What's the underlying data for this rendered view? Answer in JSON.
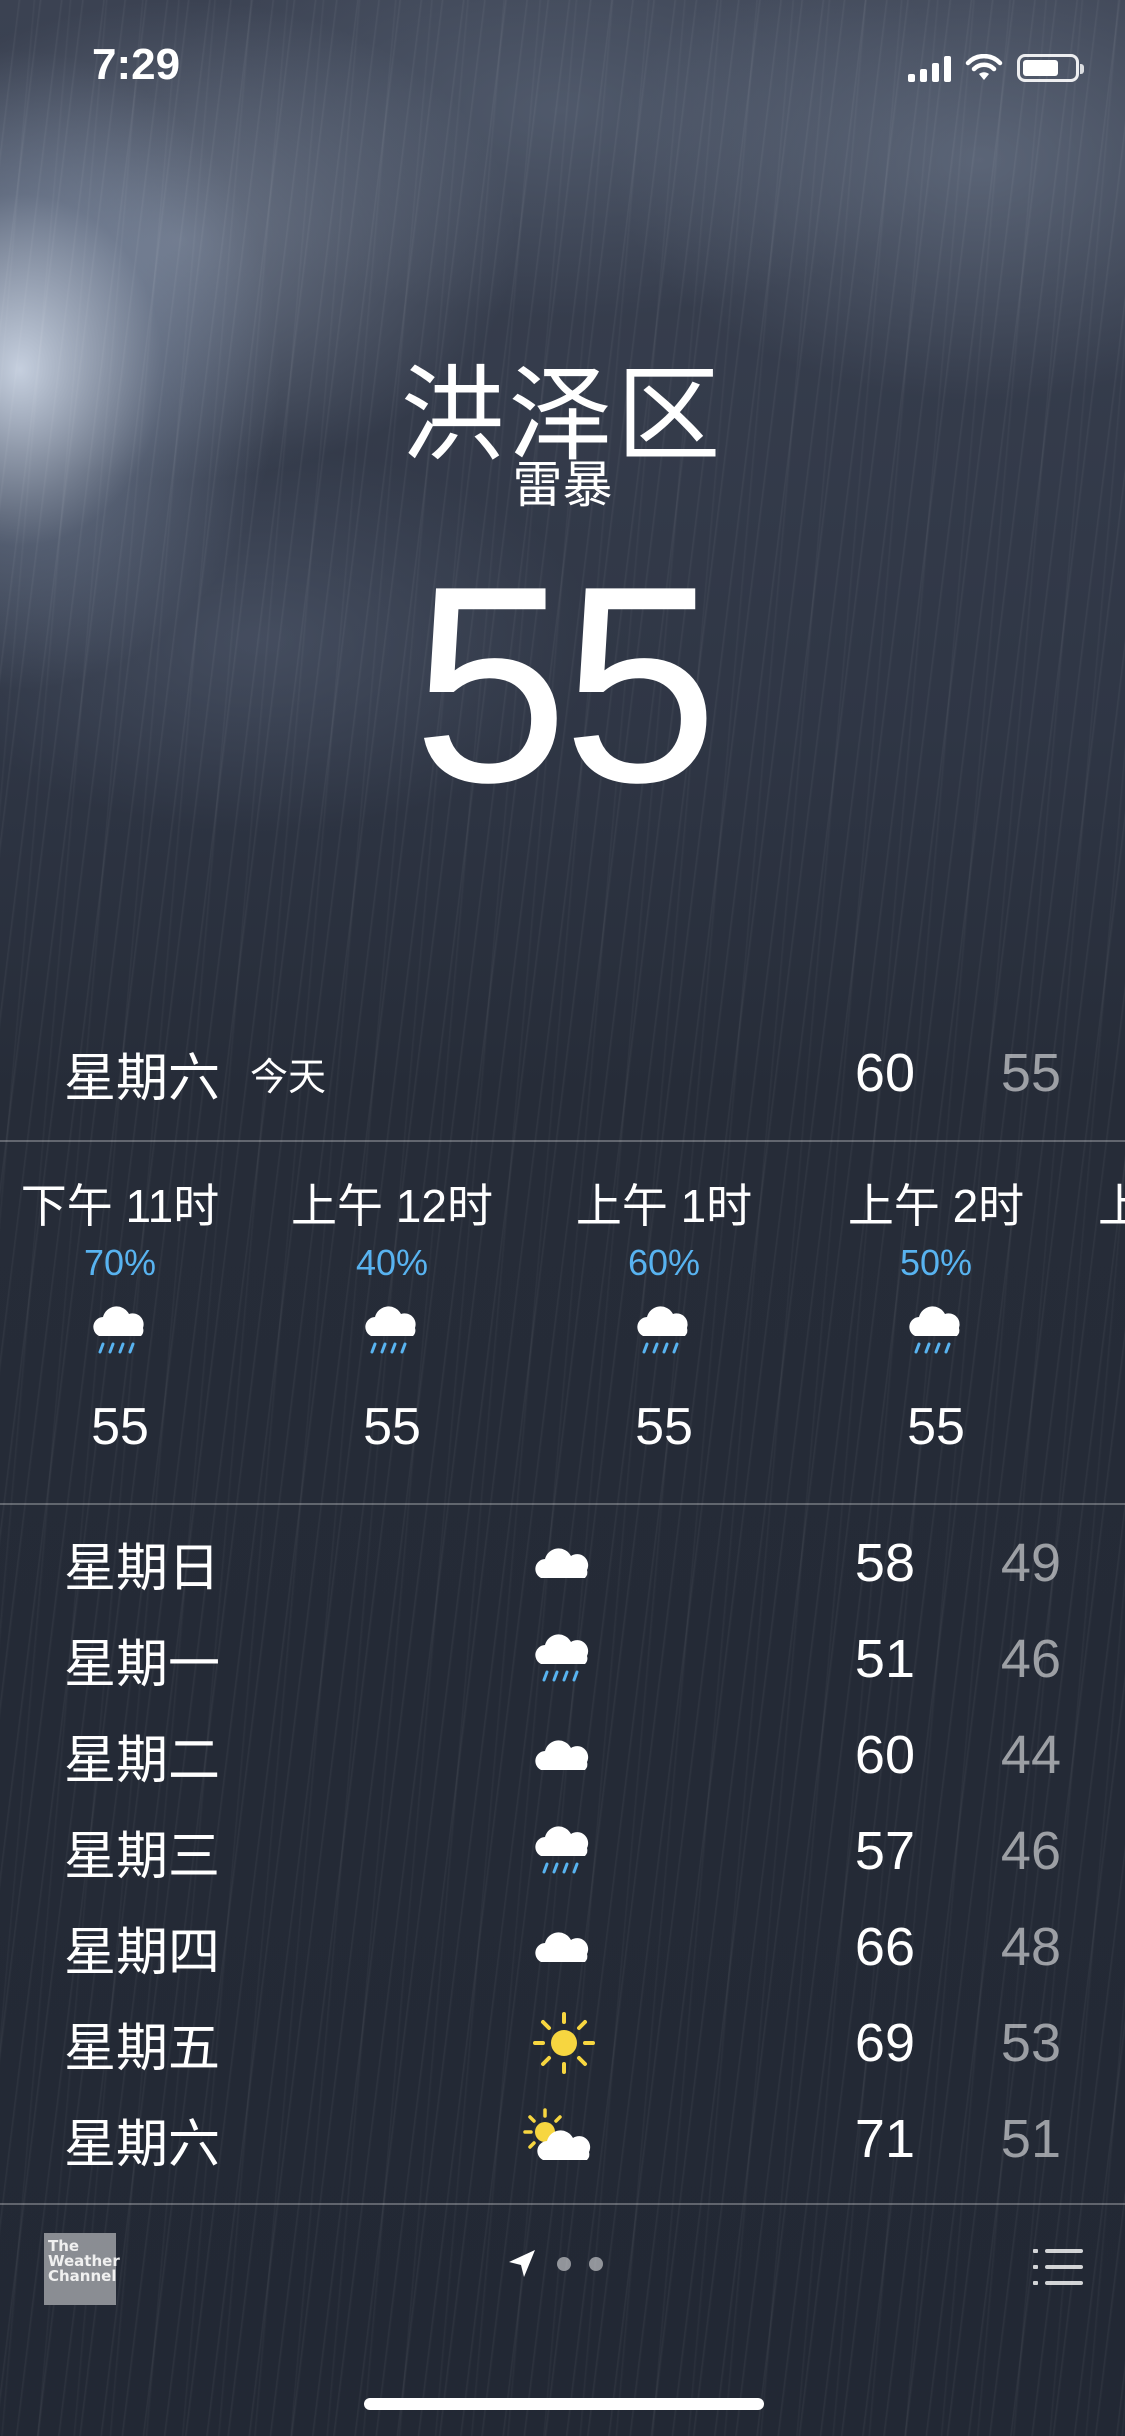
{
  "status_bar": {
    "time": "7:29",
    "battery_level_percent": 70
  },
  "location": {
    "city": "洪泽区",
    "condition": "雷暴",
    "temperature": "55"
  },
  "today": {
    "day": "星期六",
    "label": "今天",
    "high": "60",
    "low": "55"
  },
  "hourly": [
    {
      "time": "下午 11时",
      "precip": "70%",
      "icon": "rain-cloud-icon",
      "temp": "55"
    },
    {
      "time": "上午 12时",
      "precip": "40%",
      "icon": "rain-cloud-icon",
      "temp": "55"
    },
    {
      "time": "上午 1时",
      "precip": "60%",
      "icon": "rain-cloud-icon",
      "temp": "55"
    },
    {
      "time": "上午 2时",
      "precip": "50%",
      "icon": "rain-cloud-icon",
      "temp": "55"
    }
  ],
  "daily": [
    {
      "day": "星期日",
      "icon": "cloud-icon",
      "high": "58",
      "low": "49"
    },
    {
      "day": "星期一",
      "icon": "rain-cloud-icon",
      "high": "51",
      "low": "46"
    },
    {
      "day": "星期二",
      "icon": "cloud-icon",
      "high": "60",
      "low": "44"
    },
    {
      "day": "星期三",
      "icon": "rain-cloud-icon",
      "high": "57",
      "low": "46"
    },
    {
      "day": "星期四",
      "icon": "cloud-icon",
      "high": "66",
      "low": "48"
    },
    {
      "day": "星期五",
      "icon": "sun-icon",
      "high": "69",
      "low": "53"
    },
    {
      "day": "星期六",
      "icon": "partly-sunny-icon",
      "high": "71",
      "low": "51"
    }
  ],
  "footer": {
    "logo_text": [
      "The",
      "Weather",
      "Channel"
    ],
    "icons": [
      "location-arrow-icon",
      "list-icon"
    ]
  },
  "colors": {
    "precip_blue": "#58b3f0",
    "sun_yellow": "#f7d640",
    "low_temp_gray": "#9aa0aa"
  }
}
